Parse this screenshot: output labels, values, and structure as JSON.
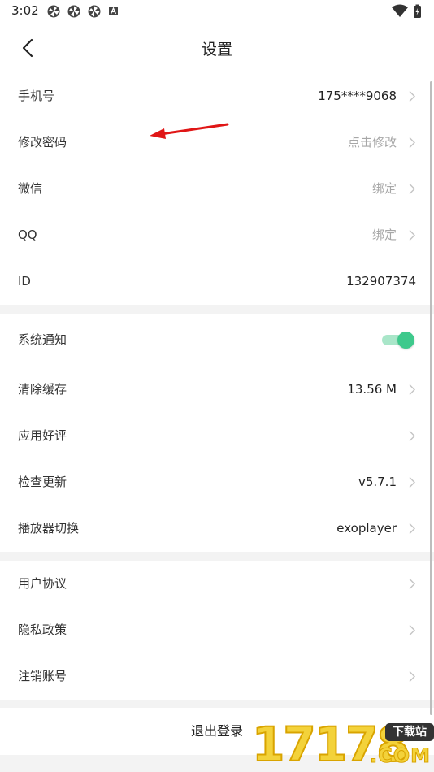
{
  "status_bar": {
    "time": "3:02",
    "left_icons": [
      "pinwheel-icon",
      "pinwheel-icon",
      "pinwheel-icon",
      "a-badge-icon"
    ],
    "right_icons": [
      "wifi-icon",
      "battery-charging-icon"
    ]
  },
  "header": {
    "title": "设置",
    "back_icon": "chevron-left-icon"
  },
  "groups": [
    {
      "rows": [
        {
          "label": "手机号",
          "value": "175****9068",
          "value_style": "dark",
          "chevron": true
        },
        {
          "label": "修改密码",
          "value": "点击修改",
          "value_style": "muted",
          "chevron": true
        },
        {
          "label": "微信",
          "value": "绑定",
          "value_style": "muted",
          "chevron": true
        },
        {
          "label": "QQ",
          "value": "绑定",
          "value_style": "muted",
          "chevron": true
        },
        {
          "label": "ID",
          "value": "132907374",
          "value_style": "dark",
          "chevron": false
        }
      ]
    },
    {
      "rows": [
        {
          "label": "系统通知",
          "toggle": true,
          "toggle_on": true
        },
        {
          "label": "清除缓存",
          "value": "13.56 M",
          "value_style": "dark",
          "chevron": true
        },
        {
          "label": "应用好评",
          "value": "",
          "chevron": true
        },
        {
          "label": "检查更新",
          "value": "v5.7.1",
          "value_style": "dark",
          "chevron": true
        },
        {
          "label": "播放器切换",
          "value": "exoplayer",
          "value_style": "dark",
          "chevron": true
        }
      ]
    },
    {
      "rows": [
        {
          "label": "用户协议",
          "value": "",
          "chevron": true
        },
        {
          "label": "隐私政策",
          "value": "",
          "chevron": true
        },
        {
          "label": "注销账号",
          "value": "",
          "chevron": true
        }
      ]
    }
  ],
  "logout_label": "退出登录",
  "colors": {
    "accent_green": "#3ec98c",
    "arrow_red": "#e01616",
    "watermark_yellow": "#f3d23a"
  },
  "watermark": {
    "digits": "17178",
    "badge": "下载站",
    "suffix": ".COM"
  }
}
